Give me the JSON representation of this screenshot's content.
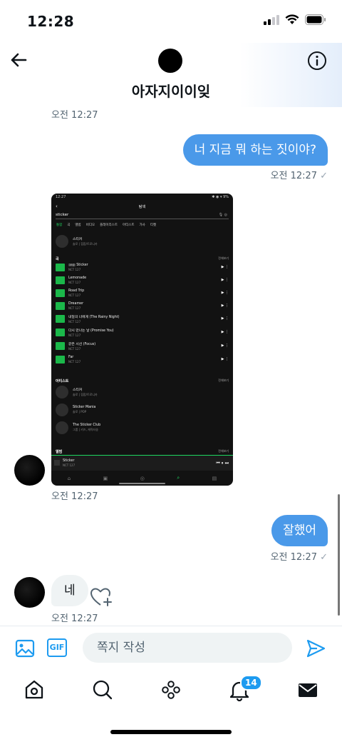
{
  "status_bar": {
    "time": "12:28",
    "icons": [
      "cellular-icon",
      "wifi-icon",
      "battery-icon"
    ]
  },
  "header": {
    "title": "아자지이이잊"
  },
  "messages": [
    {
      "direction": "in",
      "timestamp": "오전 12:27"
    },
    {
      "direction": "out",
      "text": "너 지금 뭐 하는 짓이야?",
      "timestamp": "오전 12:27",
      "status": "✓"
    },
    {
      "direction": "in",
      "type": "image",
      "timestamp": "오전 12:27"
    },
    {
      "direction": "out",
      "text": "잘했어",
      "timestamp": "오전 12:27",
      "status": "✓"
    },
    {
      "direction": "in",
      "text": "네",
      "timestamp": "오전 12:27"
    }
  ],
  "screenshot": {
    "status_time": "12:27",
    "status_right": "✱ ◉ ▾ 9%",
    "title": "탐색",
    "search_text": "sticker",
    "filters": [
      "통합",
      "곡",
      "앨범",
      "비디오",
      "플레이리스트",
      "아티스트",
      "가사",
      "티켓"
    ],
    "top_artist": {
      "name": "스티커",
      "sub": "솔로 | 힙합/트로니카"
    },
    "songs_header": "곡",
    "see_all": "전체보기",
    "songs": [
      {
        "title": "Sticker",
        "artist": "NCT 127",
        "tag": "19금"
      },
      {
        "title": "Lemonade",
        "artist": "NCT 127"
      },
      {
        "title": "Road Trip",
        "artist": "NCT 127"
      },
      {
        "title": "Dreamer",
        "artist": "NCT 127"
      },
      {
        "title": "내일의 너에게 (The Rainy Night)",
        "artist": "NCT 127"
      },
      {
        "title": "다시 만나는 날 (Promise You)",
        "artist": "NCT 127"
      },
      {
        "title": "같은 시선 (Focus)",
        "artist": "NCT 127"
      },
      {
        "title": "Far",
        "artist": "NCT 127"
      }
    ],
    "artists_header": "아티스트",
    "artists": [
      {
        "name": "스티커",
        "sub": "솔로 | 힙합/트로니카"
      },
      {
        "name": "Sticker Mania",
        "sub": "솔로 | POP"
      },
      {
        "name": "The Sticker Club",
        "sub": "그룹 | 키즈, 캐릭터송"
      }
    ],
    "albums_header": "앨범",
    "now_playing": {
      "title": "Sticker",
      "artist": "NCT 127"
    }
  },
  "composer": {
    "placeholder": "쪽지 작성",
    "gif_label": "GIF"
  },
  "tabbar": {
    "notifications_badge": "14"
  },
  "colors": {
    "accent": "#1d9bf0",
    "bubble_out": "#4a99e9",
    "bubble_in": "#eff3f4",
    "spotify_green": "#1ed760"
  }
}
